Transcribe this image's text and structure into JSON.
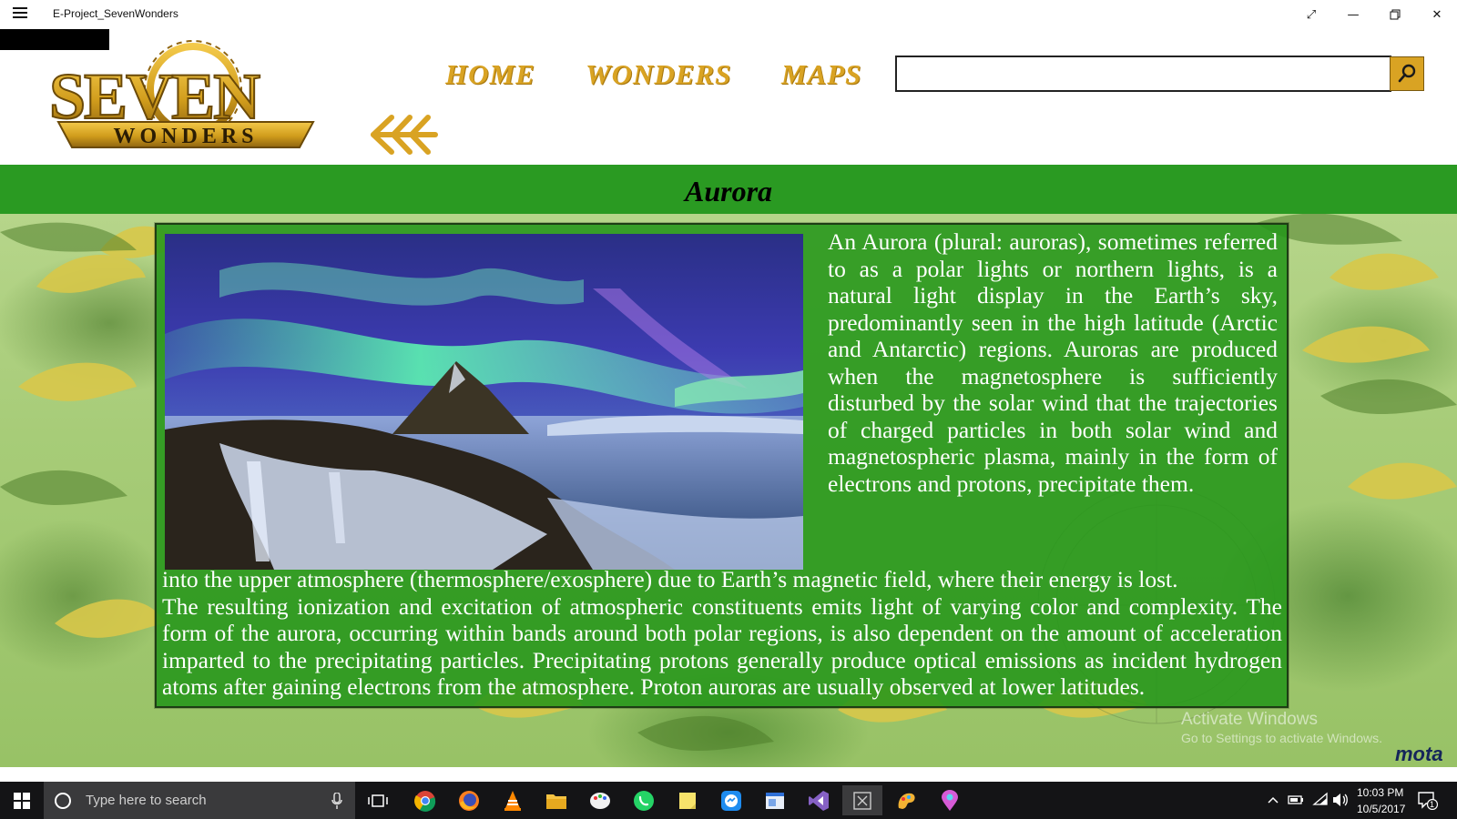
{
  "window": {
    "title": "E-Project_SevenWonders",
    "controls": [
      "expand-icon",
      "minimize-icon",
      "restore-icon",
      "close-icon"
    ]
  },
  "logo": {
    "line1": "SEVEN",
    "line2": "WONDERS"
  },
  "nav": {
    "home": "HOME",
    "wonders": "WONDERS",
    "maps": "MAPS"
  },
  "search": {
    "placeholder": "",
    "value": ""
  },
  "page": {
    "title": "Aurora",
    "paragraph_right": "An Aurora (plural: auroras), sometimes referred to as a polar lights or northern lights, is a natural light display in the Earth’s sky, predominantly seen in the high latitude (Arctic and Antarctic) regions. Auroras are produced when the magnetosphere is sufficiently disturbed by the solar wind that the trajectories of charged particles in both solar wind and magnetospheric plasma, mainly in the form of electrons and protons, precipitate them.",
    "paragraph_bottom_1": "into the upper atmosphere (thermosphere/exosphere) due to Earth’s magnetic field, where their energy is lost.",
    "paragraph_bottom_2": "The resulting ionization and excitation of atmospheric constituents emits light of varying color and complexity. The form of the aurora, occurring within bands around both polar regions, is also dependent on the amount of acceleration imparted to the precipitating particles. Precipitating protons generally produce optical emissions as incident hydrogen atoms after gaining electrons from the atmosphere. Proton auroras are usually observed at lower latitudes."
  },
  "watermark": {
    "line1": "Activate Windows",
    "line2": "Go to Settings to activate Windows.",
    "brand": "mota"
  },
  "taskbar": {
    "search_placeholder": "Type here to search",
    "apps": [
      "chrome-icon",
      "firefox-icon",
      "vlc-icon",
      "file-explorer-icon",
      "paint-icon",
      "whatsapp-icon",
      "sticky-notes-icon",
      "messenger-icon",
      "app-window-icon",
      "visual-studio-icon",
      "seven-wonders-app-icon",
      "paint3d-icon",
      "maps-pin-icon"
    ],
    "time": "10:03 PM",
    "date": "10/5/2017",
    "notification_count": "1"
  },
  "colors": {
    "gold": "#d9a323",
    "banner_green": "#2a9a22",
    "panel_green": "#26961a",
    "taskbar": "#141416"
  }
}
